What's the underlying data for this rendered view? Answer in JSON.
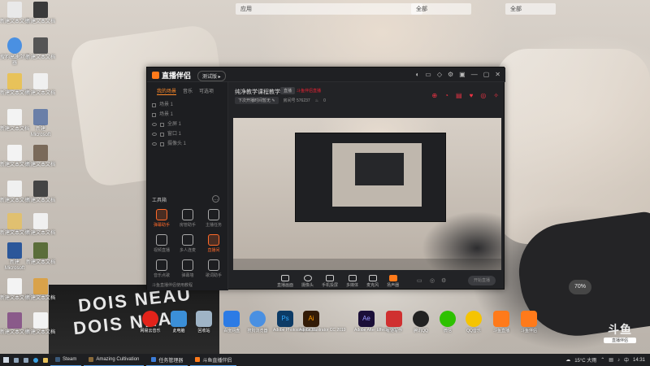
{
  "desktop": {
    "topstrip": [
      "应用",
      "全部",
      "全部"
    ],
    "left_icons": [
      {
        "label": "新建文本文档"
      },
      {
        "label": "新建文本文档"
      },
      {
        "label": "搜狗高速浏览器"
      },
      {
        "label": "新建文本文档"
      },
      {
        "label": "新建文本文档"
      },
      {
        "label": "新建文本文档"
      },
      {
        "label": "新建文本文档"
      },
      {
        "label": "新建Microsoft"
      },
      {
        "label": "新建文本文档"
      },
      {
        "label": "新建文本文档"
      }
    ],
    "notification_chip": "70%",
    "poster_line1": "DOIS NEAU",
    "poster_line2": "DOIS NEAU"
  },
  "app": {
    "logo": "直播伴侣",
    "version_badge": "测试版 ▸",
    "top_icons": [
      "◐",
      "▭",
      "◇",
      "⚙",
      "▣",
      "—",
      "▢",
      "✕"
    ],
    "sidebar": {
      "tabs": [
        "我的场景",
        "音乐",
        "可选项"
      ],
      "scenes": [
        "场景 1",
        "场景 1",
        "全屏 1",
        "窗口 1",
        "摄像头 1"
      ],
      "tools_title": "工具箱",
      "tools": [
        {
          "label": "弹幕助手",
          "active": true
        },
        {
          "label": "房管助手",
          "active": false
        },
        {
          "label": "主播任务",
          "active": false
        },
        {
          "label": "视频直播",
          "active": false
        },
        {
          "label": "多人连麦",
          "active": false
        },
        {
          "label": "直播间",
          "active": true
        },
        {
          "label": "音乐点歌",
          "active": false
        },
        {
          "label": "弹幕墙",
          "active": false
        },
        {
          "label": "歌词助手",
          "active": false
        }
      ],
      "footer": "斗鱼直播伴侣使用教程"
    },
    "room": {
      "title": "纯净教学课程教学",
      "tag": "直播",
      "red_note": "斗鱼伴侣直播",
      "sub_button": "下次开播时间暂无 ✎",
      "sub_text": "房间号 576237",
      "count": "0"
    },
    "right_controls": [
      "⊕",
      "◔",
      "▤",
      "♥",
      "◎",
      "✧"
    ],
    "bottombar": [
      {
        "label": "直播画面"
      },
      {
        "label": "摄像头"
      },
      {
        "label": "手机投屏"
      },
      {
        "label": "多媒体"
      },
      {
        "label": "麦克风"
      },
      {
        "label": "扬声器"
      }
    ],
    "start_live": "开始直播"
  },
  "dock": [
    {
      "label": "网易云音乐",
      "color": "#e2231a"
    },
    {
      "label": "此电脑",
      "color": "#3b8fd8"
    },
    {
      "label": "回收站",
      "color": "#9fb4c6"
    },
    {
      "label": "百度网盘",
      "color": "#2c7be5"
    },
    {
      "label": "搜狗浏览器",
      "color": "#4a90e2"
    },
    {
      "label": "Adobe Photoshop CC 2",
      "color": "#0d3b66"
    },
    {
      "label": "Adobe Illustrator CC 2019",
      "color": "#331b06"
    },
    {
      "label": "Adobe After Effects CC",
      "color": "#1b0f38"
    },
    {
      "label": "有道写作",
      "color": "#d03030"
    },
    {
      "label": "腾讯QQ",
      "color": "#222222"
    },
    {
      "label": "微信",
      "color": "#2dc100"
    },
    {
      "label": "QQ音乐",
      "color": "#f5c400"
    },
    {
      "label": "斗鱼直播",
      "color": "#ff7a1a"
    },
    {
      "label": "斗鱼伴侣",
      "color": "#ff7a1a"
    }
  ],
  "watermark": {
    "big": "斗鱼",
    "small": "直播伴侣"
  },
  "taskbar": {
    "apps": [
      {
        "label": "Steam",
        "color": "#1b2838"
      },
      {
        "label": "Amazing Cultivation",
        "color": "#6a4b2a"
      },
      {
        "label": "任务管理器",
        "color": "#3c7dd9"
      },
      {
        "label": "斗鱼直播伴侣",
        "color": "#ff7a1a"
      }
    ],
    "weather": "15°C 大雨",
    "lang": "中",
    "time": "14:31"
  }
}
